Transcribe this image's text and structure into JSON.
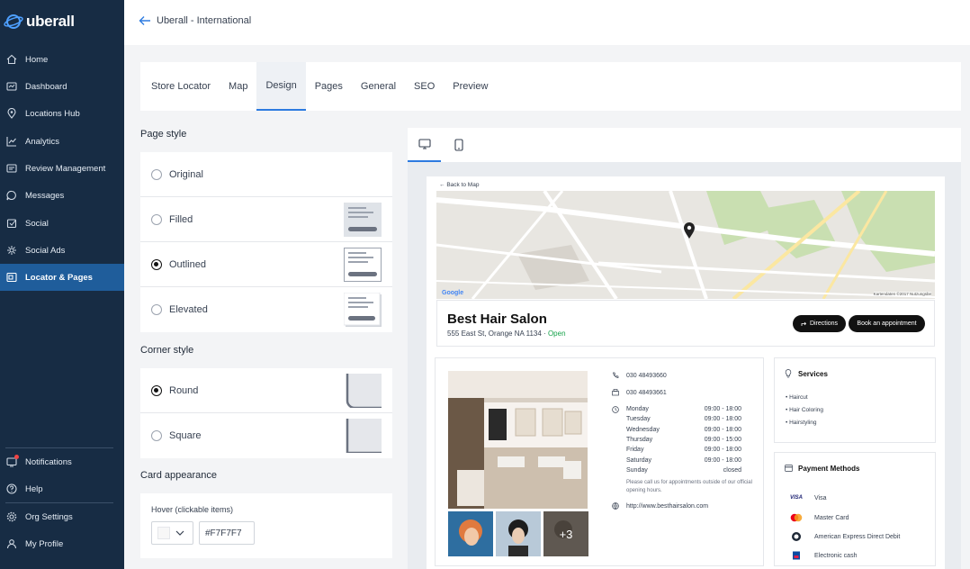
{
  "brand": {
    "name": "uberall"
  },
  "sidebar": {
    "items": [
      {
        "label": "Home",
        "icon": "home-icon"
      },
      {
        "label": "Dashboard",
        "icon": "dashboard-icon"
      },
      {
        "label": "Locations Hub",
        "icon": "location-pin-icon"
      },
      {
        "label": "Analytics",
        "icon": "analytics-icon"
      },
      {
        "label": "Review Management",
        "icon": "review-icon"
      },
      {
        "label": "Messages",
        "icon": "messages-icon"
      },
      {
        "label": "Social",
        "icon": "social-icon"
      },
      {
        "label": "Social Ads",
        "icon": "social-ads-icon"
      },
      {
        "label": "Locator & Pages",
        "icon": "locator-icon",
        "active": true
      }
    ],
    "bottom_items": [
      {
        "label": "Notifications",
        "icon": "bell-icon"
      },
      {
        "label": "Help",
        "icon": "help-icon"
      },
      {
        "label": "Org Settings",
        "icon": "gear-icon"
      },
      {
        "label": "My Profile",
        "icon": "user-icon"
      }
    ]
  },
  "header": {
    "title": "Uberall - International"
  },
  "tabs": [
    {
      "label": "Store Locator"
    },
    {
      "label": "Map"
    },
    {
      "label": "Design",
      "active": true
    },
    {
      "label": "Pages"
    },
    {
      "label": "General"
    },
    {
      "label": "SEO"
    },
    {
      "label": "Preview"
    }
  ],
  "page_style": {
    "title": "Page style",
    "options": [
      {
        "label": "Original",
        "selected": false
      },
      {
        "label": "Filled",
        "selected": false
      },
      {
        "label": "Outlined",
        "selected": true
      },
      {
        "label": "Elevated",
        "selected": false
      }
    ]
  },
  "corner_style": {
    "title": "Corner style",
    "options": [
      {
        "label": "Round",
        "selected": true
      },
      {
        "label": "Square",
        "selected": false
      }
    ]
  },
  "card_appearance": {
    "title": "Card appearance",
    "hover_label": "Hover (clickable items)",
    "hover_color": "#F7F7F7"
  },
  "preview": {
    "back_link": "Back to Map",
    "business": {
      "name": "Best Hair Salon",
      "address": "555 East St, Orange NA 1134",
      "separator": "·",
      "status": "Open",
      "directions_label": "Directions",
      "appointment_label": "Book an appointment"
    },
    "contact": {
      "phone": "030 48493660",
      "fax": "030 48493661",
      "website": "http://www.besthairsalon.com"
    },
    "hours": [
      {
        "day": "Monday",
        "time": "09:00 - 18:00"
      },
      {
        "day": "Tuesday",
        "time": "09:00 - 18:00"
      },
      {
        "day": "Wednesday",
        "time": "09:00 - 18:00"
      },
      {
        "day": "Thursday",
        "time": "09:00 - 15:00"
      },
      {
        "day": "Friday",
        "time": "09:00 - 18:00"
      },
      {
        "day": "Saturday",
        "time": "09:00 - 18:00"
      },
      {
        "day": "Sunday",
        "time": "closed"
      }
    ],
    "hours_note": "Please call us for appointments outside of our official opening hours.",
    "gallery_more": "+3",
    "services": {
      "title": "Services",
      "items": [
        "Haircut",
        "Hair Coloring",
        "Hairstyling"
      ]
    },
    "payment": {
      "title": "Payment Methods",
      "items": [
        {
          "logo": "VISA",
          "label": "Visa"
        },
        {
          "logo": "mc",
          "label": "Master Card"
        },
        {
          "logo": "amex",
          "label": "American Express Direct Debit"
        },
        {
          "logo": "ec",
          "label": "Electronic cash"
        }
      ]
    },
    "map": {
      "google_label": "Google",
      "map_credit": "Kartendaten ©2017   Nutzungsbe"
    }
  },
  "colors": {
    "sidebar": "#172c44",
    "active": "#1f5d9b",
    "accent": "#2d7be0",
    "open": "#16a34a"
  }
}
